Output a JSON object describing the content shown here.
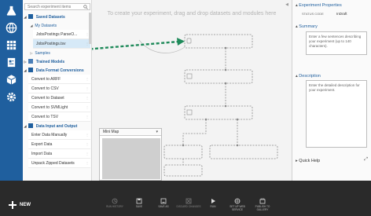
{
  "colors": {
    "rail": "#1f5f9e",
    "accent": "#1f5f9e",
    "arrow": "#1f8a5a",
    "canvas": "#f3f3f3",
    "bottombar": "#2a2a2a"
  },
  "rail": {
    "icons": [
      "flask-icon",
      "globe-icon",
      "database-icon",
      "document-icon",
      "cube-icon",
      "settings-icon"
    ]
  },
  "palette": {
    "search_placeholder": "Search experiment items",
    "saved_datasets": "Saved Datasets",
    "my_datasets": "My Datasets",
    "my_datasets_items": [
      "JobsPostings ParseO...",
      "JobsPostings.tsv"
    ],
    "samples": "Samples",
    "trained_models": "Trained Models",
    "data_format_conversions": "Data Format Conversions",
    "conversion_items": [
      "Convert to ARFF",
      "Convert to CSV",
      "Convert to Dataset",
      "Convert to SVMLight",
      "Convert to TSV"
    ],
    "data_input_output": "Data Input and Output",
    "io_items": [
      "Enter Data Manually",
      "Export Data",
      "Import Data",
      "Unpack Zipped Datasets"
    ]
  },
  "canvas": {
    "hint": "To create your experiment, drag and drop datasets and modules here",
    "minimap_title": "Mini Map"
  },
  "properties": {
    "title": "Experiment Properties",
    "status_code_label": "STATUS CODE",
    "status_code_value": "InDraft",
    "summary_title": "Summary",
    "summary_placeholder": "Enter a few sentences describing your experiment (up to 140 characters).",
    "description_title": "Description",
    "description_placeholder": "Enter the detailed description for your experiment.",
    "quick_help": "Quick Help"
  },
  "bottombar": {
    "new_label": "NEW",
    "tools": [
      {
        "label": "RUN HISTORY",
        "icon": "history-icon",
        "enabled": false
      },
      {
        "label": "SAVE",
        "icon": "save-icon",
        "enabled": true
      },
      {
        "label": "SAVE AS",
        "icon": "save-as-icon",
        "enabled": true
      },
      {
        "label": "DISCARD CHANGES",
        "icon": "discard-icon",
        "enabled": false
      },
      {
        "label": "RUN",
        "icon": "run-icon",
        "enabled": true
      },
      {
        "label": "SET UP WEB SERVICE",
        "icon": "web-service-icon",
        "enabled": true
      },
      {
        "label": "PUBLISH TO GALLERY",
        "icon": "gallery-icon",
        "enabled": true
      }
    ]
  }
}
